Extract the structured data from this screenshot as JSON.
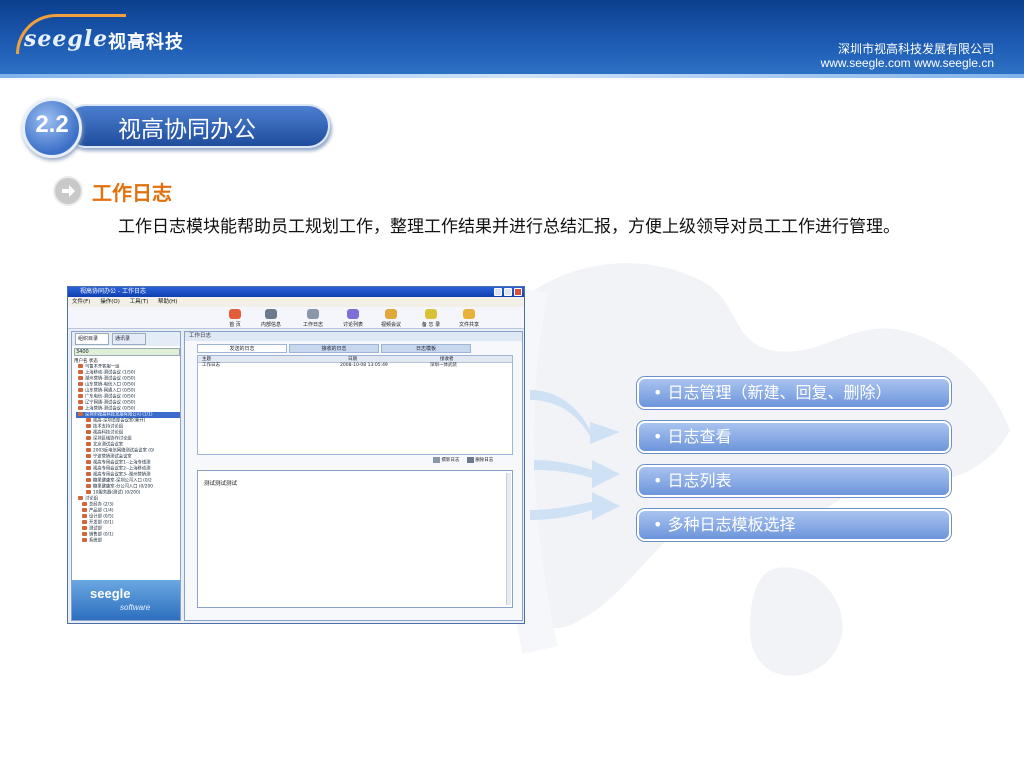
{
  "header": {
    "logo_en": "seegle",
    "logo_cn": "视高科技",
    "company": "深圳市视高科技发展有限公司",
    "website": "www.seegle.com  www.seegle.cn"
  },
  "section": {
    "number": "2.2",
    "title": "视高协同办公",
    "subheading": "工作日志",
    "description": "工作日志模块能帮助员工规划工作，整理工作结果并进行总结汇报，方便上级领导对员工工作进行管理。"
  },
  "app_window": {
    "title": "视高协同办公 - 工作日志",
    "menu": [
      "文件(F)",
      "操作(O)",
      "工具(T)",
      "帮助(H)"
    ],
    "toolbar": [
      "首 页",
      "内部信息",
      "工作日志",
      "讨论列表",
      "视频会议",
      "备 忘 录",
      "文件共享"
    ],
    "side_tabs": [
      "组织目录",
      "通讯录"
    ],
    "search_value": "3400",
    "side_column": "用户名   状态",
    "tree": [
      "乌鲁木齐客服一组",
      "上海移动-测试会议 (1/50)",
      "湖州营销-测试会议 (0/50)",
      "山东营销-电信入口 (0/50)",
      "山东营销-网通入口 (0/50)",
      "广东电信-测试会议 (0/50)",
      "辽宁网通-测试会议 (0/50)",
      "上海营销-测试会议 (0/50)",
      "深圳市视高科技发展有限公司 (1/1)",
      "视高-深圳总部会议室(重开)",
      "技术支持讨论组",
      "视高科技讨论组",
      "深圳区域协作讨论组",
      "北京测试会议室",
      "2003反电信网络测试会议室 (0/",
      "宁波营销测试会议室",
      "视高专用会议室1--上海专线测",
      "视高专用会议室2--上海移动测",
      "视高专用会议室3--湖州营销测",
      "糖果健康室-深圳公司入口 (0/2",
      "糖果健康室-分公司入口 (0/200",
      "10服务器(测试) (0/200)",
      "讨论组",
      "总经办 (2/3)",
      "产品部 (1/4)",
      "设计部 (0/5)",
      "开发部 (0/1)",
      "测试部",
      "销售部 (0/1)",
      "系统部"
    ],
    "side_logo_en": "seegle",
    "side_logo_sub": "software",
    "panel_title": "工作日志",
    "tabs": [
      "发送的日志",
      "接收的日志",
      "日志模板"
    ],
    "grid_headers": [
      "主题",
      "日期",
      "接收者"
    ],
    "grid_rows": [
      {
        "subject": "工作日志",
        "date": "2008-10-08 13:05:49",
        "receiver": "深圳一体武装"
      }
    ],
    "actions": [
      "撰新日志",
      "删除日志"
    ],
    "editor_text": "测试测试测试"
  },
  "features": [
    "• 日志管理（新建、回复、删除）",
    "• 日志查看",
    "• 日志列表",
    "• 多种日志模板选择"
  ],
  "colors": {
    "header_blue": "#1d5bb3",
    "accent_orange": "#e2700c",
    "pill_blue": "#6d95db"
  }
}
